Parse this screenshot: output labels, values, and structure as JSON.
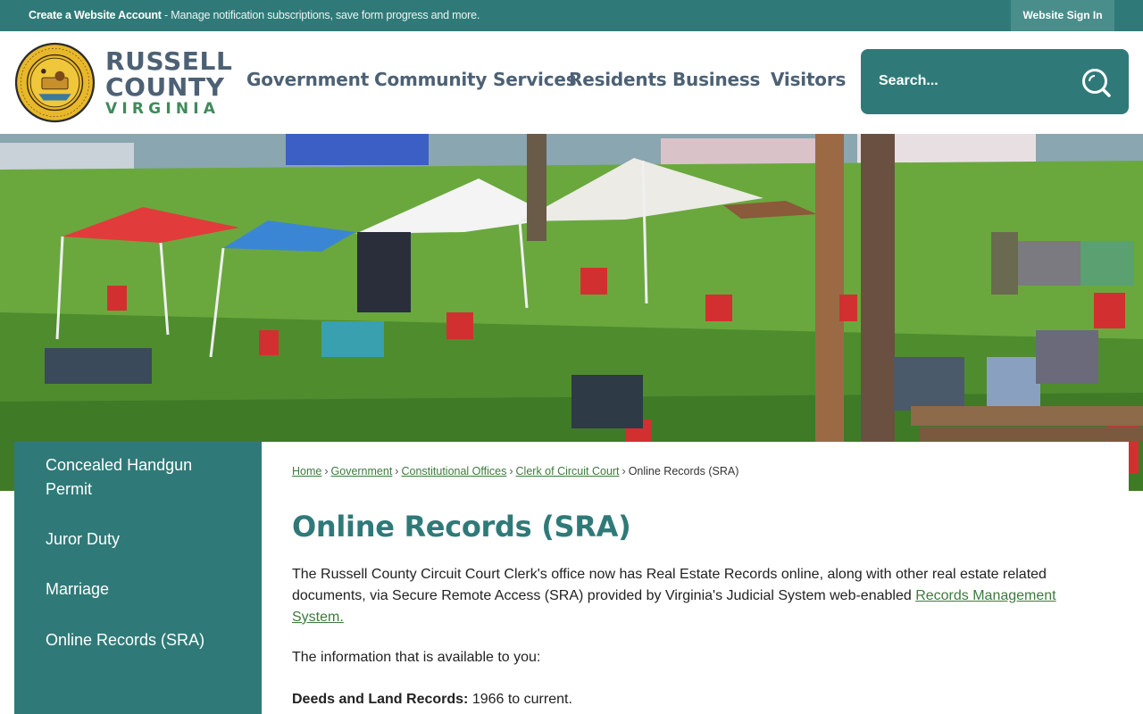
{
  "topbar": {
    "account_link": "Create a Website Account",
    "account_desc": " - Manage notification subscriptions, save form progress and more.",
    "signin_label": "Website Sign In"
  },
  "header": {
    "logo_line1": "RUSSELL",
    "logo_line2": "COUNTY",
    "logo_line3": "VIRGINIA",
    "nav": [
      "Government",
      "Community Services",
      "Residents",
      "Business",
      "Visitors"
    ],
    "search_placeholder": "Search..."
  },
  "sidebar": {
    "items": [
      "Concealed Handgun Permit",
      "Juror Duty",
      "Marriage",
      "Online Records (SRA)"
    ]
  },
  "breadcrumb": {
    "links": [
      "Home",
      "Government",
      "Constitutional Offices",
      "Clerk of Circuit Court"
    ],
    "current": "Online Records (SRA)"
  },
  "main": {
    "title": "Online Records (SRA)",
    "intro": "The Russell County Circuit Court Clerk's office now has Real Estate Records online, along with other real estate related documents, via Secure Remote Access (SRA) provided by Virginia's Judicial System web-enabled ",
    "intro_link": "Records Management System.",
    "available": "The information that is available to you:",
    "deeds_label": "Deeds and Land Records:",
    "deeds_value": " 1966 to current."
  },
  "colors": {
    "teal": "#2f7a78",
    "nav_text": "#4d6174",
    "link_green": "#3d7a3e"
  }
}
